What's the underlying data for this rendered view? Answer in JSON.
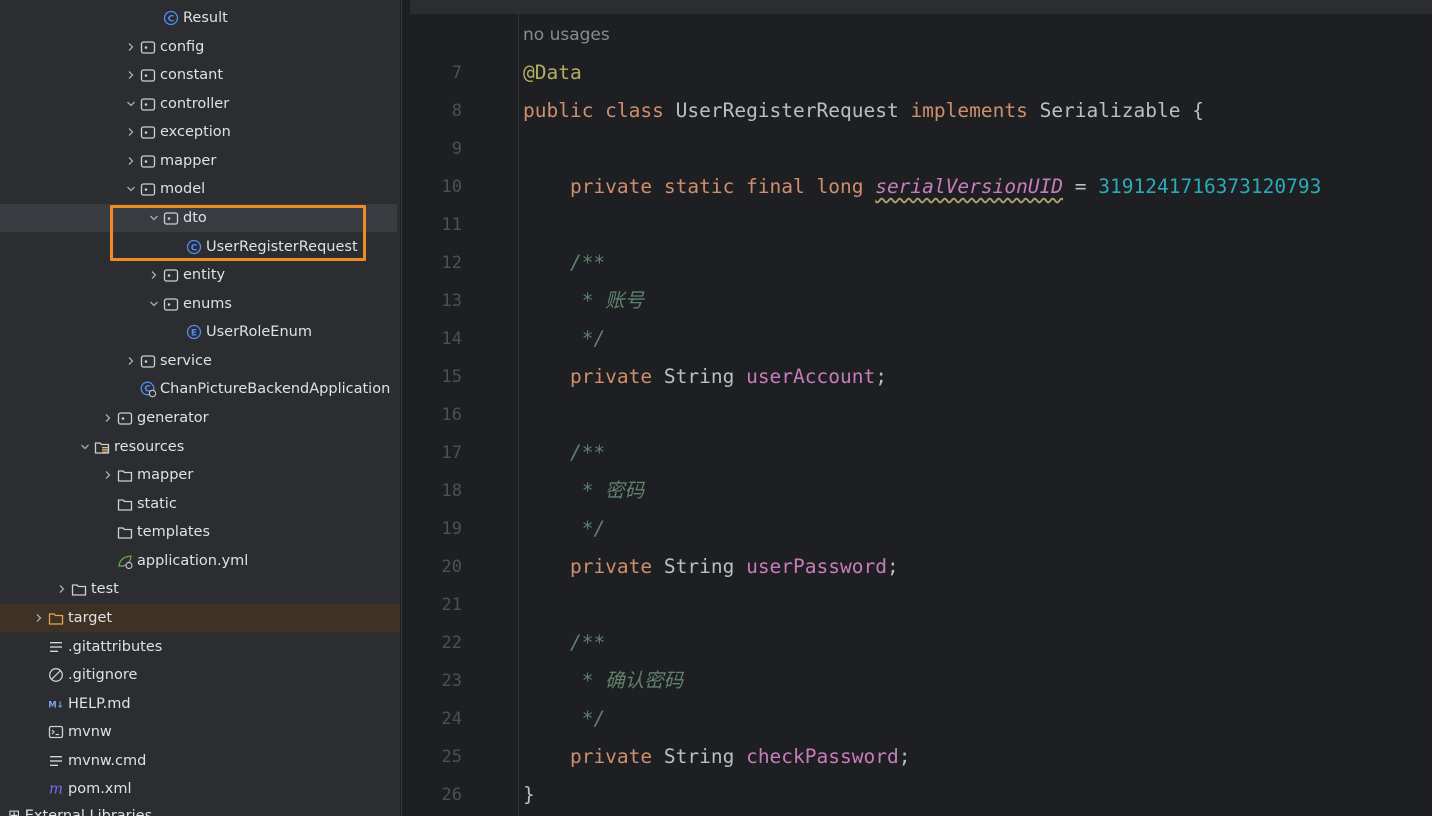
{
  "tree": {
    "items": [
      {
        "label": "Result",
        "icon": "class-icon",
        "expand": "none",
        "indent": 2
      },
      {
        "label": "config",
        "icon": "package-icon",
        "expand": "collapsed",
        "indent": 1
      },
      {
        "label": "constant",
        "icon": "package-icon",
        "expand": "collapsed",
        "indent": 1
      },
      {
        "label": "controller",
        "icon": "package-icon",
        "expand": "expanded",
        "indent": 1
      },
      {
        "label": "exception",
        "icon": "package-icon",
        "expand": "collapsed",
        "indent": 1
      },
      {
        "label": "mapper",
        "icon": "package-icon",
        "expand": "collapsed",
        "indent": 1
      },
      {
        "label": "model",
        "icon": "package-icon",
        "expand": "expanded",
        "indent": 1
      },
      {
        "label": "dto",
        "icon": "package-icon",
        "expand": "expanded",
        "indent": 2,
        "selected": true
      },
      {
        "label": "UserRegisterRequest",
        "icon": "class-icon",
        "expand": "none",
        "indent": 3
      },
      {
        "label": "entity",
        "icon": "package-icon",
        "expand": "collapsed",
        "indent": 2
      },
      {
        "label": "enums",
        "icon": "package-icon",
        "expand": "expanded",
        "indent": 2
      },
      {
        "label": "UserRoleEnum",
        "icon": "enum-icon",
        "expand": "none",
        "indent": 3
      },
      {
        "label": "service",
        "icon": "package-icon",
        "expand": "collapsed",
        "indent": 1
      },
      {
        "label": "ChanPictureBackendApplication",
        "icon": "spring-boot-class-icon",
        "expand": "none",
        "indent": 1
      },
      {
        "label": "generator",
        "icon": "package-icon",
        "expand": "collapsed",
        "indent": 0
      },
      {
        "label": "resources",
        "icon": "resources-folder-icon",
        "expand": "expanded",
        "indent": -1
      },
      {
        "label": "mapper",
        "icon": "folder-icon",
        "expand": "collapsed",
        "indent": 0
      },
      {
        "label": "static",
        "icon": "folder-icon",
        "expand": "none",
        "indent": 0
      },
      {
        "label": "templates",
        "icon": "folder-icon",
        "expand": "none",
        "indent": 0
      },
      {
        "label": "application.yml",
        "icon": "yaml-file-icon",
        "expand": "none",
        "indent": 0
      },
      {
        "label": "test",
        "icon": "folder-icon",
        "expand": "collapsed",
        "indent": -2
      },
      {
        "label": "target",
        "icon": "target-folder-icon",
        "expand": "collapsed",
        "indent": -3,
        "target": true
      },
      {
        "label": ".gitattributes",
        "icon": "text-file-icon",
        "expand": "none",
        "indent": -3
      },
      {
        "label": ".gitignore",
        "icon": "ignore-file-icon",
        "expand": "none",
        "indent": -3
      },
      {
        "label": "HELP.md",
        "icon": "markdown-file-icon",
        "expand": "none",
        "indent": -3
      },
      {
        "label": "mvnw",
        "icon": "shell-file-icon",
        "expand": "none",
        "indent": -3
      },
      {
        "label": "mvnw.cmd",
        "icon": "text-file-icon",
        "expand": "none",
        "indent": -3
      },
      {
        "label": "pom.xml",
        "icon": "maven-file-icon",
        "expand": "none",
        "indent": -3
      }
    ],
    "cut_off_label": "External Libraries"
  },
  "editor": {
    "usage_hint": "no usages",
    "top_line_number": "6",
    "lines": [
      {
        "n": "7",
        "tokens": [
          {
            "t": "@Data",
            "c": "ann"
          }
        ]
      },
      {
        "n": "8",
        "tokens": [
          {
            "t": "public class ",
            "c": "kw"
          },
          {
            "t": "UserRegisterRequest ",
            "c": "cls"
          },
          {
            "t": "implements ",
            "c": "kw"
          },
          {
            "t": "Serializable {",
            "c": "cls"
          }
        ]
      },
      {
        "n": "9",
        "tokens": []
      },
      {
        "n": "10",
        "tokens": [
          {
            "t": "    private static final long ",
            "c": "kw"
          },
          {
            "t": "serialVersionUID",
            "c": "sfld"
          },
          {
            "t": " = ",
            "c": "cls"
          },
          {
            "t": "3191241716373120793",
            "c": "num"
          }
        ]
      },
      {
        "n": "11",
        "tokens": []
      },
      {
        "n": "12",
        "tokens": [
          {
            "t": "    /**",
            "c": "cmt"
          }
        ]
      },
      {
        "n": "13",
        "tokens": [
          {
            "t": "     * 账号",
            "c": "cmt"
          }
        ]
      },
      {
        "n": "14",
        "tokens": [
          {
            "t": "     */",
            "c": "cmt"
          }
        ]
      },
      {
        "n": "15",
        "tokens": [
          {
            "t": "    private ",
            "c": "kw"
          },
          {
            "t": "String ",
            "c": "cls"
          },
          {
            "t": "userAccount",
            "c": "fld"
          },
          {
            "t": ";",
            "c": "cls"
          }
        ]
      },
      {
        "n": "16",
        "tokens": []
      },
      {
        "n": "17",
        "tokens": [
          {
            "t": "    /**",
            "c": "cmt"
          }
        ]
      },
      {
        "n": "18",
        "tokens": [
          {
            "t": "     * 密码",
            "c": "cmt"
          }
        ]
      },
      {
        "n": "19",
        "tokens": [
          {
            "t": "     */",
            "c": "cmt"
          }
        ]
      },
      {
        "n": "20",
        "tokens": [
          {
            "t": "    private ",
            "c": "kw"
          },
          {
            "t": "String ",
            "c": "cls"
          },
          {
            "t": "userPassword",
            "c": "fld"
          },
          {
            "t": ";",
            "c": "cls"
          }
        ]
      },
      {
        "n": "21",
        "tokens": []
      },
      {
        "n": "22",
        "tokens": [
          {
            "t": "    /**",
            "c": "cmt"
          }
        ]
      },
      {
        "n": "23",
        "tokens": [
          {
            "t": "     * 确认密码",
            "c": "cmt"
          }
        ]
      },
      {
        "n": "24",
        "tokens": [
          {
            "t": "     */",
            "c": "cmt"
          }
        ]
      },
      {
        "n": "25",
        "tokens": [
          {
            "t": "    private ",
            "c": "kw"
          },
          {
            "t": "String ",
            "c": "cls"
          },
          {
            "t": "checkPassword",
            "c": "fld"
          },
          {
            "t": ";",
            "c": "cls"
          }
        ]
      },
      {
        "n": "26",
        "tokens": [
          {
            "t": "}",
            "c": "cls"
          }
        ]
      }
    ]
  },
  "colors": {
    "tree_bg": "#2b2d30",
    "editor_bg": "#1e1f22",
    "highlight_box": "#f08a24",
    "keyword": "#cf8e6d",
    "annotation": "#b3ae60",
    "field": "#c77dbb",
    "number": "#2aacb8",
    "comment": "#5f826b"
  }
}
